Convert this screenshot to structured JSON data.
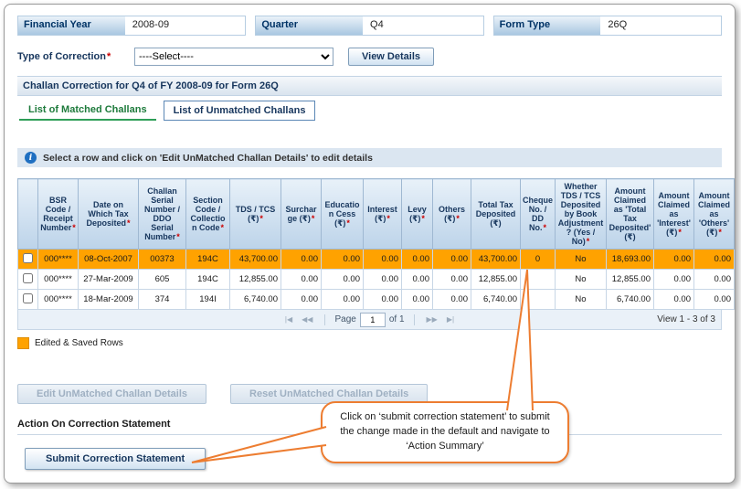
{
  "filters": {
    "financial_year": {
      "label": "Financial Year",
      "value": "2008-09"
    },
    "quarter": {
      "label": "Quarter",
      "value": "Q4"
    },
    "form_type": {
      "label": "Form Type",
      "value": "26Q"
    }
  },
  "correction": {
    "label": "Type of Correction",
    "required": "*",
    "selected": "----Select----",
    "view_details_label": "View Details"
  },
  "section_title": "Challan Correction for Q4 of FY 2008-09 for Form 26Q",
  "tabs": {
    "matched": "List of Matched Challans",
    "unmatched": "List of Unmatched Challans"
  },
  "info_text": "Select a row and click on 'Edit UnMatched Challan Details' to edit details",
  "table": {
    "columns": [
      {
        "label": "BSR Code / Receipt Number",
        "required": true
      },
      {
        "label": "Date on Which Tax Deposited",
        "required": true
      },
      {
        "label": "Challan Serial Number / DDO Serial Number",
        "required": true
      },
      {
        "label": "Section Code / Collection Code",
        "required": true
      },
      {
        "label": "TDS / TCS (₹)",
        "required": true
      },
      {
        "label": "Surcharge (₹)",
        "required": true
      },
      {
        "label": "Education Cess (₹)",
        "required": true
      },
      {
        "label": "Interest (₹)",
        "required": true
      },
      {
        "label": "Levy (₹)",
        "required": true
      },
      {
        "label": "Others (₹)",
        "required": true
      },
      {
        "label": "Total Tax Deposited (₹)",
        "required": false
      },
      {
        "label": "Cheque No. / DD No.",
        "required": true
      },
      {
        "label": "Whether TDS / TCS Deposited by Book Adjustment? (Yes / No)",
        "required": true
      },
      {
        "label": "Amount Claimed as 'Total Tax Deposited' (₹)",
        "required": false
      },
      {
        "label": "Amount Claimed as 'Interest' (₹)",
        "required": true
      },
      {
        "label": "Amount Claimed as 'Others' (₹)",
        "required": true
      }
    ],
    "aligns": [
      "center",
      "center",
      "center",
      "center",
      "right",
      "right",
      "right",
      "right",
      "right",
      "right",
      "right",
      "center",
      "center",
      "right",
      "right",
      "right"
    ],
    "rows": [
      {
        "highlighted": true,
        "cells": [
          "000****",
          "08-Oct-2007",
          "00373",
          "194C",
          "43,700.00",
          "0.00",
          "0.00",
          "0.00",
          "0.00",
          "0.00",
          "43,700.00",
          "0",
          "No",
          "18,693.00",
          "0.00",
          "0.00"
        ]
      },
      {
        "highlighted": false,
        "cells": [
          "000****",
          "27-Mar-2009",
          "605",
          "194C",
          "12,855.00",
          "0.00",
          "0.00",
          "0.00",
          "0.00",
          "0.00",
          "12,855.00",
          "",
          "No",
          "12,855.00",
          "0.00",
          "0.00"
        ]
      },
      {
        "highlighted": false,
        "cells": [
          "000****",
          "18-Mar-2009",
          "374",
          "194I",
          "6,740.00",
          "0.00",
          "0.00",
          "0.00",
          "0.00",
          "0.00",
          "6,740.00",
          "",
          "No",
          "6,740.00",
          "0.00",
          "0.00"
        ]
      }
    ],
    "pager": {
      "first": "|◀",
      "prev": "◀◀",
      "page_label": "Page",
      "page": "1",
      "of_label": "of 1",
      "next": "▶▶",
      "last": "▶|",
      "view_text": "View 1 - 3 of 3"
    }
  },
  "legend_text": "Edited & Saved Rows",
  "buttons": {
    "edit": "Edit UnMatched Challan Details",
    "reset": "Reset UnMatched Challan Details"
  },
  "action_heading": "Action On Correction Statement",
  "submit_label": "Submit Correction Statement",
  "callout_text": "Click on ‘submit correction statement’ to submit the change made in the default and navigate to ‘Action Summary’"
}
